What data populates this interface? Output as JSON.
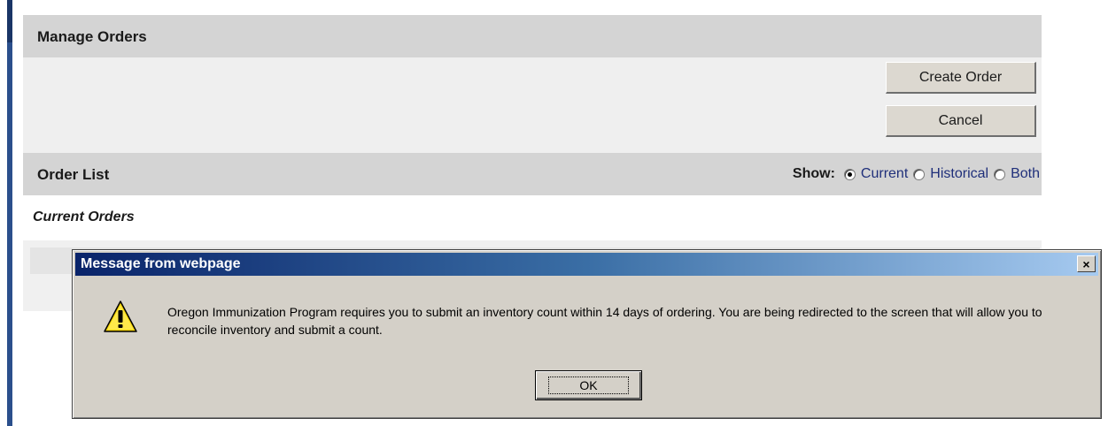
{
  "manage_orders": {
    "title": "Manage Orders",
    "create_order_label": "Create Order",
    "cancel_label": "Cancel"
  },
  "order_list": {
    "title": "Order List",
    "show_label": "Show:",
    "options": [
      {
        "label": "Current",
        "checked": true
      },
      {
        "label": "Historical",
        "checked": false
      },
      {
        "label": "Both",
        "checked": false
      }
    ],
    "current_orders_label": "Current Orders"
  },
  "dialog": {
    "title": "Message from webpage",
    "close_label": "×",
    "message": "Oregon Immunization Program requires you to submit an inventory count within 14 days of ordering.  You are being redirected to the screen that will allow you to reconcile inventory and submit a count.",
    "ok_label": "OK",
    "icon": "warning-icon"
  },
  "colors": {
    "header_bg": "#d4d4d4",
    "panel_bg": "#efefef",
    "dialog_bg": "#d4d0c8",
    "titlebar_start": "#0a246a",
    "titlebar_end": "#a6caf0",
    "left_bar": "#2b4f8c"
  }
}
